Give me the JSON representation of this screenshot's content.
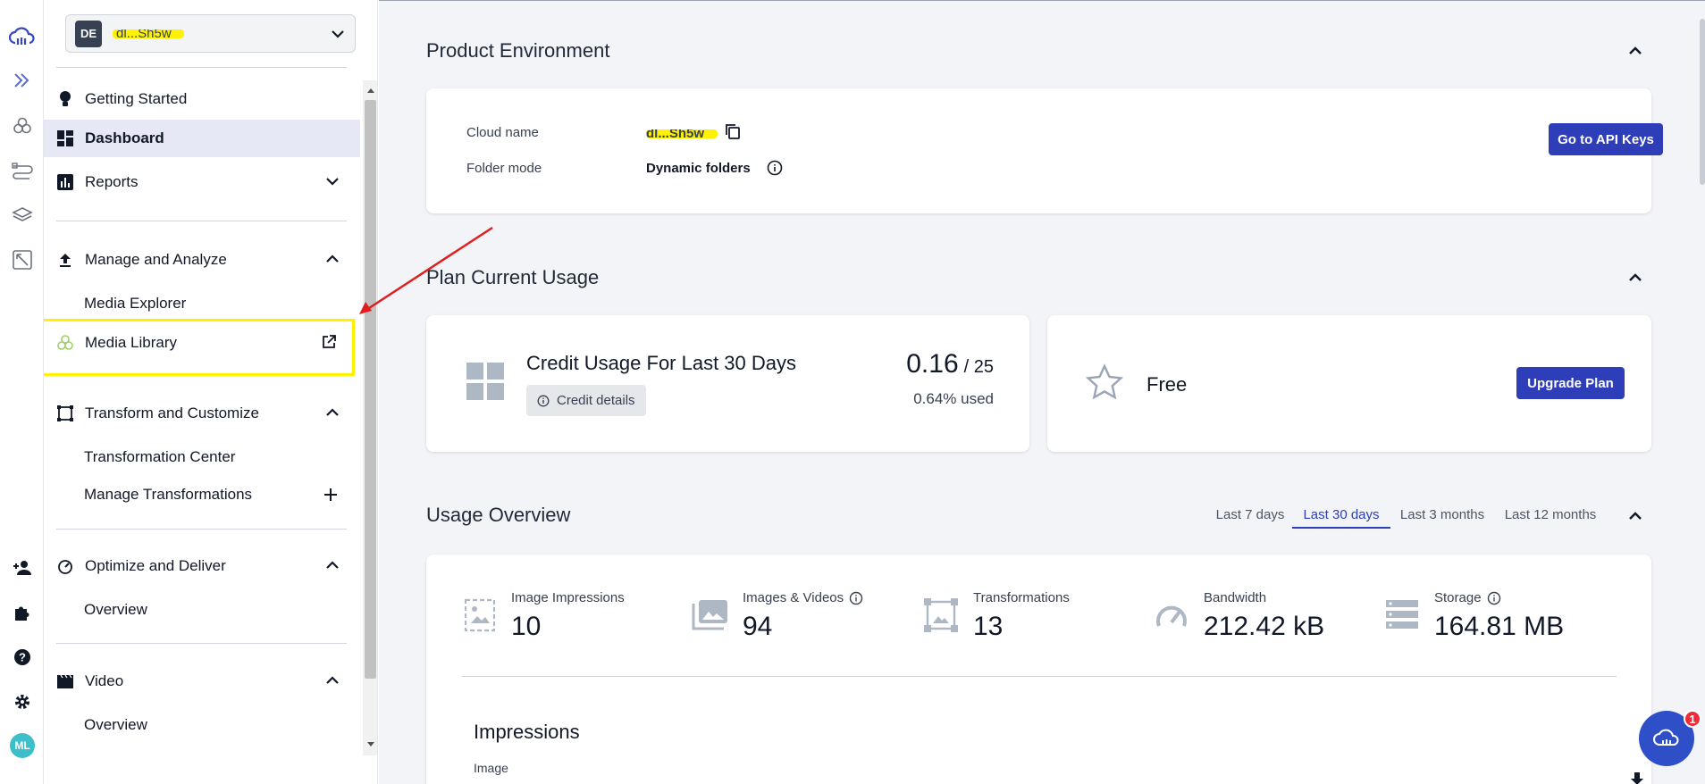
{
  "env": {
    "badge": "DE",
    "name": "dl...Sh5w"
  },
  "sidebar": {
    "getting_started": "Getting Started",
    "dashboard": "Dashboard",
    "reports": "Reports",
    "manage_analyze": "Manage and Analyze",
    "media_explorer": "Media Explorer",
    "media_library": "Media Library",
    "transform_customize": "Transform and Customize",
    "transformation_center": "Transformation Center",
    "manage_transformations": "Manage Transformations",
    "optimize_deliver": "Optimize and Deliver",
    "optimize_overview": "Overview",
    "video": "Video",
    "video_overview": "Overview"
  },
  "rail": {
    "avatar": "ML"
  },
  "product_env": {
    "title": "Product Environment",
    "cloud_name_label": "Cloud name",
    "cloud_name_value": "dl...Sh5w",
    "folder_mode_label": "Folder mode",
    "folder_mode_value": "Dynamic folders",
    "api_keys_button": "Go to API Keys"
  },
  "plan": {
    "title": "Plan Current Usage",
    "credit_title": "Credit Usage For Last 30 Days",
    "credit_details": "Credit details",
    "credit_used": "0.16",
    "credit_total": "/ 25",
    "credit_percent": "0.64% used",
    "plan_name": "Free",
    "upgrade_button": "Upgrade Plan"
  },
  "usage": {
    "title": "Usage Overview",
    "tabs": [
      "Last 7 days",
      "Last 30 days",
      "Last 3 months",
      "Last 12 months"
    ],
    "active_tab": "Last 30 days",
    "stats": [
      {
        "label": "Image Impressions",
        "value": "10"
      },
      {
        "label": "Images & Videos",
        "value": "94"
      },
      {
        "label": "Transformations",
        "value": "13"
      },
      {
        "label": "Bandwidth",
        "value": "212.42 kB"
      },
      {
        "label": "Storage",
        "value": "164.81 MB"
      }
    ],
    "impressions_title": "Impressions",
    "impressions_sub": "Image"
  },
  "chat": {
    "badge_count": "1"
  },
  "colors": {
    "accent": "#2e3db8",
    "highlight": "#fff200",
    "annotation_arrow": "#e11d1d"
  }
}
